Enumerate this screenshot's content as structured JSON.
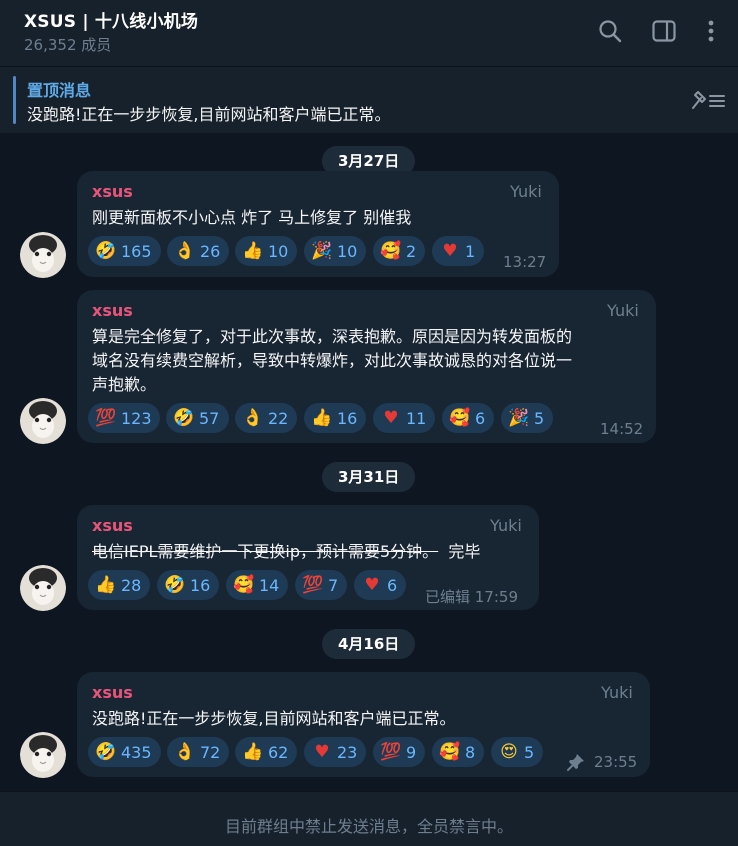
{
  "header": {
    "title": "XSUS | 十八线小机场",
    "members": "26,352 成员",
    "search_icon": "search-icon",
    "sidebar_icon": "sidebar-toggle-icon",
    "menu_icon": "more-vertical-icon"
  },
  "pinned": {
    "title": "置顶消息",
    "text": "没跑路!正在一步步恢复,目前网站和客户端已正常。",
    "icon": "unpin-list-icon"
  },
  "dates": [
    "3月27日",
    "3月31日",
    "4月16日"
  ],
  "messages": [
    {
      "sender": "xsus",
      "badge": "Yuki",
      "text": [
        "刚更新面板不小心点 炸了   马上修复了  别催我"
      ],
      "time": "13:27",
      "reactions": [
        {
          "emoji": "🤣",
          "count": "165"
        },
        {
          "emoji": "👌",
          "count": "26"
        },
        {
          "emoji": "👍",
          "count": "10"
        },
        {
          "emoji": "🎉",
          "count": "10"
        },
        {
          "emoji": "🥰",
          "count": "2"
        },
        {
          "emoji": "♥",
          "count": "1"
        }
      ]
    },
    {
      "sender": "xsus",
      "badge": "Yuki",
      "text": [
        "算是完全修复了，对于此次事故，深表抱歉。原因是因为转发面板的",
        "域名没有续费空解析，导致中转爆炸，对此次事故诚恳的对各位说一",
        "声抱歉。"
      ],
      "time": "14:52",
      "reactions": [
        {
          "emoji": "💯",
          "count": "123"
        },
        {
          "emoji": "🤣",
          "count": "57"
        },
        {
          "emoji": "👌",
          "count": "22"
        },
        {
          "emoji": "👍",
          "count": "16"
        },
        {
          "emoji": "♥",
          "count": "11"
        },
        {
          "emoji": "🥰",
          "count": "6"
        },
        {
          "emoji": "🎉",
          "count": "5"
        }
      ]
    },
    {
      "sender": "xsus",
      "badge": "Yuki",
      "text_strike": "电信IEPL需要维护一下更换ip，预计需要5分钟。",
      "text_after": "  完毕",
      "time": "已编辑 17:59",
      "reactions": [
        {
          "emoji": "👍",
          "count": "28"
        },
        {
          "emoji": "🤣",
          "count": "16"
        },
        {
          "emoji": "🥰",
          "count": "14"
        },
        {
          "emoji": "💯",
          "count": "7"
        },
        {
          "emoji": "♥",
          "count": "6"
        }
      ]
    },
    {
      "sender": "xsus",
      "badge": "Yuki",
      "text": [
        "没跑路!正在一步步恢复,目前网站和客户端已正常。"
      ],
      "time": "23:55",
      "pinned_icon": "pin-icon",
      "reactions": [
        {
          "emoji": "🤣",
          "count": "435"
        },
        {
          "emoji": "👌",
          "count": "72"
        },
        {
          "emoji": "👍",
          "count": "62"
        },
        {
          "emoji": "♥",
          "count": "23"
        },
        {
          "emoji": "💯",
          "count": "9"
        },
        {
          "emoji": "🥰",
          "count": "8"
        },
        {
          "emoji": "😍",
          "count": "5"
        }
      ]
    }
  ],
  "footer": {
    "text": "目前群组中禁止发送消息，全员禁言中。"
  },
  "colors": {
    "background": "#0e1621",
    "panel": "#17212b",
    "bubble": "#182533",
    "sender": "#e8557a",
    "accent": "#5fa9e8",
    "reaction_bg": "#1e3a55",
    "reaction_text": "#6ab7ff",
    "muted": "#6d7f8f"
  }
}
